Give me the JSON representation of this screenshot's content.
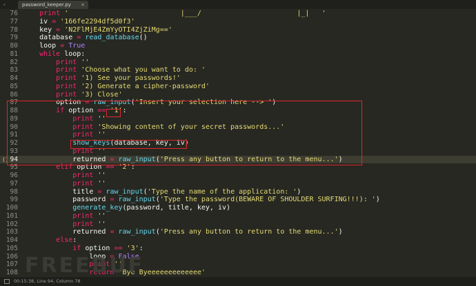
{
  "tab": {
    "title": "password_keeper.py",
    "close": "×"
  },
  "status": {
    "text": "00:15:38, Line 94, Column 78"
  },
  "watermark": "FREEBUF",
  "editor": {
    "cursor_line": "94",
    "gutter_marker": "()",
    "lines": [
      {
        "n": "76",
        "t": "    print '                           |___/                       |_|   '"
      },
      {
        "n": "77",
        "t": "    iv = '166fe2294df5d0f3'"
      },
      {
        "n": "78",
        "t": "    key = 'N2FlMjE4ZmYyOTI4ZjZiMg=='"
      },
      {
        "n": "79",
        "t": "    database = read_database()"
      },
      {
        "n": "80",
        "t": "    loop = True"
      },
      {
        "n": "81",
        "t": "    while loop:"
      },
      {
        "n": "82",
        "t": "        print ''"
      },
      {
        "n": "83",
        "t": "        print 'Choose what you want to do: '"
      },
      {
        "n": "84",
        "t": "        print '1) See your passwords!'"
      },
      {
        "n": "85",
        "t": "        print '2) Generate a cipher-password'"
      },
      {
        "n": "86",
        "t": "        print '3) Close'"
      },
      {
        "n": "87",
        "t": "        option = raw_input('Insert your selection here --> ')"
      },
      {
        "n": "88",
        "t": "        if option == '1':"
      },
      {
        "n": "89",
        "t": "            print ''"
      },
      {
        "n": "90",
        "t": "            print 'Showing content of your secret passwords...'"
      },
      {
        "n": "91",
        "t": "            print ''"
      },
      {
        "n": "92",
        "t": "            show_keys(database, key, iv)"
      },
      {
        "n": "93",
        "t": "            print ''"
      },
      {
        "n": "94",
        "t": "            returned = raw_input('Press any button to return to the menu...')"
      },
      {
        "n": "95",
        "t": "        elif option == '2':"
      },
      {
        "n": "96",
        "t": "            print ''"
      },
      {
        "n": "97",
        "t": "            print ''"
      },
      {
        "n": "98",
        "t": "            title = raw_input('Type the name of the application: ')"
      },
      {
        "n": "99",
        "t": "            password = raw_input('Type the password(BEWARE OF SHOULDER SURFING!!!): ')"
      },
      {
        "n": "100",
        "t": "            generate_key(password, title, key, iv)"
      },
      {
        "n": "101",
        "t": "            print ''"
      },
      {
        "n": "102",
        "t": "            print ''"
      },
      {
        "n": "103",
        "t": "            returned = raw_input('Press any button to return to the menu...')"
      },
      {
        "n": "104",
        "t": "        else:"
      },
      {
        "n": "105",
        "t": "            if option == '3':"
      },
      {
        "n": "106",
        "t": "                loop = False"
      },
      {
        "n": "107",
        "t": "                print ''"
      },
      {
        "n": "108",
        "t": "                return 'Bye Byeeeeeeeeeeeee'"
      }
    ]
  },
  "colors": {
    "background": "#272822",
    "keyword": "#f92672",
    "string": "#e6db74",
    "function": "#66d9ef",
    "constant": "#ae81ff",
    "highlight_box": "#e0262b"
  }
}
